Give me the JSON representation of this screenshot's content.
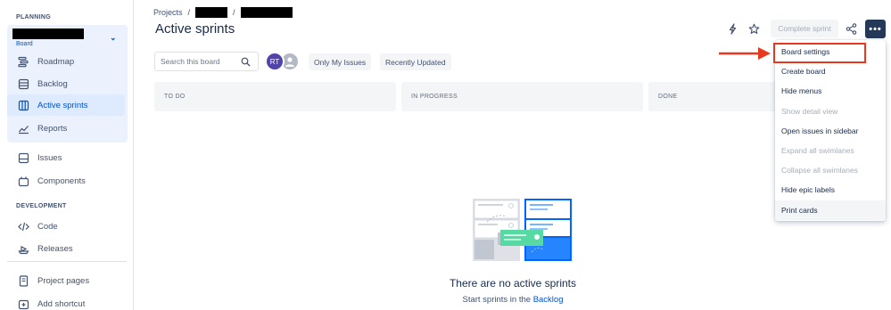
{
  "sidebar": {
    "planning_label": "PLANNING",
    "project_sub": "Board",
    "items_planning": [
      {
        "label": "Roadmap",
        "icon": "roadmap-icon"
      },
      {
        "label": "Backlog",
        "icon": "backlog-icon"
      },
      {
        "label": "Active sprints",
        "icon": "board-icon",
        "active": true
      },
      {
        "label": "Reports",
        "icon": "reports-icon"
      }
    ],
    "items_other": [
      {
        "label": "Issues",
        "icon": "issues-icon"
      },
      {
        "label": "Components",
        "icon": "components-icon"
      }
    ],
    "development_label": "DEVELOPMENT",
    "items_dev": [
      {
        "label": "Code",
        "icon": "code-icon"
      },
      {
        "label": "Releases",
        "icon": "releases-icon"
      }
    ],
    "items_bottom": [
      {
        "label": "Project pages",
        "icon": "pages-icon"
      },
      {
        "label": "Add shortcut",
        "icon": "shortcut-icon"
      }
    ]
  },
  "breadcrumb": {
    "projects": "Projects",
    "sep": "/"
  },
  "page_title": "Active sprints",
  "toolbar": {
    "complete_sprint": "Complete sprint",
    "more": "•••"
  },
  "filters": {
    "search_placeholder": "Search this board",
    "avatar_initials": "RT",
    "only_my_issues": "Only My Issues",
    "recently_updated": "Recently Updated"
  },
  "columns": [
    "TO DO",
    "IN PROGRESS",
    "DONE"
  ],
  "empty_state": {
    "title": "There are no active sprints",
    "subtitle_prefix": "Start sprints in the",
    "subtitle_link": "Backlog"
  },
  "menu": {
    "items": [
      {
        "label": "Board settings",
        "disabled": false
      },
      {
        "label": "Create board",
        "disabled": false
      },
      {
        "label": "Hide menus",
        "disabled": false
      },
      {
        "label": "Show detail view",
        "disabled": true
      },
      {
        "label": "Open issues in sidebar",
        "disabled": false
      },
      {
        "label": "Expand all swimlanes",
        "disabled": true
      },
      {
        "label": "Collapse all swimlanes",
        "disabled": true
      },
      {
        "label": "Hide epic labels",
        "disabled": false
      },
      {
        "label": "Print cards",
        "disabled": false,
        "hover": true
      }
    ]
  },
  "colors": {
    "accent": "#0052CC",
    "annotation": "#E8391E"
  }
}
